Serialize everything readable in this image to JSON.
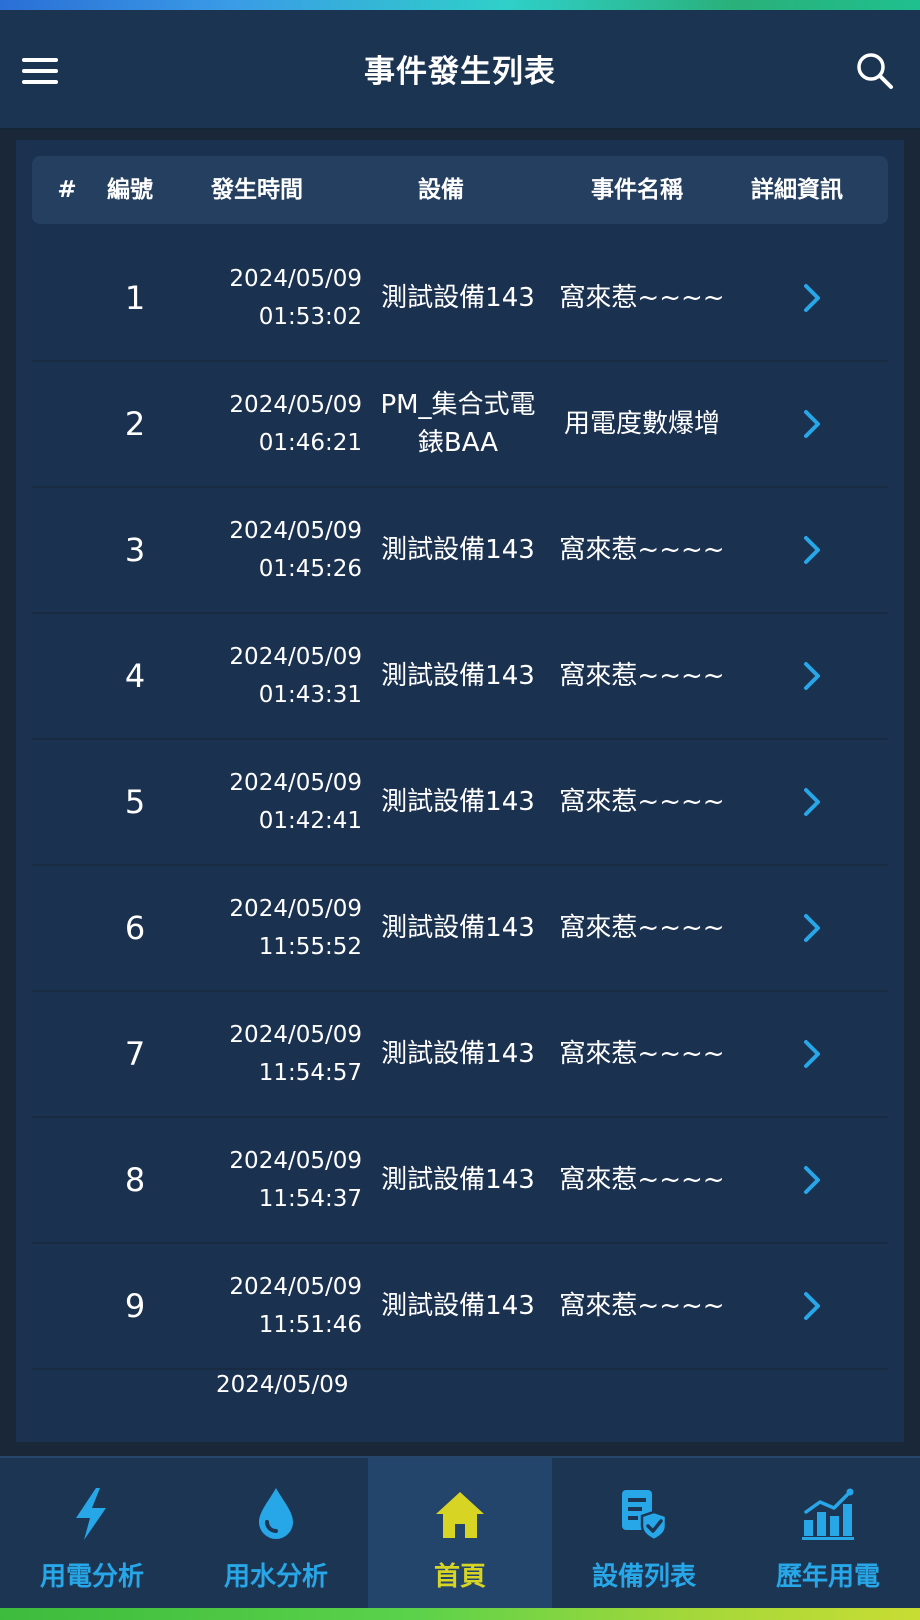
{
  "header": {
    "title": "事件發生列表",
    "menu_icon": "hamburger-menu-icon",
    "search_icon": "search-icon"
  },
  "table": {
    "headers": {
      "hash": "#",
      "number": "編號",
      "time": "發生時間",
      "device": "設備",
      "event": "事件名稱",
      "detail": "詳細資訊"
    },
    "rows": [
      {
        "no": "1",
        "date": "2024/05/09",
        "time": "01:53:02",
        "device": "測試設備143",
        "event": "窩來惹~~~~"
      },
      {
        "no": "2",
        "date": "2024/05/09",
        "time": "01:46:21",
        "device": "PM_集合式電錶BAA",
        "event": "用電度數爆增"
      },
      {
        "no": "3",
        "date": "2024/05/09",
        "time": "01:45:26",
        "device": "測試設備143",
        "event": "窩來惹~~~~"
      },
      {
        "no": "4",
        "date": "2024/05/09",
        "time": "01:43:31",
        "device": "測試設備143",
        "event": "窩來惹~~~~"
      },
      {
        "no": "5",
        "date": "2024/05/09",
        "time": "01:42:41",
        "device": "測試設備143",
        "event": "窩來惹~~~~"
      },
      {
        "no": "6",
        "date": "2024/05/09",
        "time": "11:55:52",
        "device": "測試設備143",
        "event": "窩來惹~~~~"
      },
      {
        "no": "7",
        "date": "2024/05/09",
        "time": "11:54:57",
        "device": "測試設備143",
        "event": "窩來惹~~~~"
      },
      {
        "no": "8",
        "date": "2024/05/09",
        "time": "11:54:37",
        "device": "測試設備143",
        "event": "窩來惹~~~~"
      },
      {
        "no": "9",
        "date": "2024/05/09",
        "time": "11:51:46",
        "device": "測試設備143",
        "event": "窩來惹~~~~"
      }
    ],
    "partial_row_date": "2024/05/09",
    "detail_icon": "chevron-right-icon"
  },
  "bottom_nav": {
    "items": [
      {
        "label": "用電分析",
        "icon": "lightning-icon"
      },
      {
        "label": "用水分析",
        "icon": "water-drop-icon"
      },
      {
        "label": "首頁",
        "icon": "home-icon",
        "active": true
      },
      {
        "label": "設備列表",
        "icon": "device-list-icon"
      },
      {
        "label": "歷年用電",
        "icon": "bar-chart-icon"
      }
    ]
  },
  "colors": {
    "accent": "#27a6e8",
    "active": "#d8d424",
    "background": "#1b3150",
    "header": "#1a3452"
  }
}
